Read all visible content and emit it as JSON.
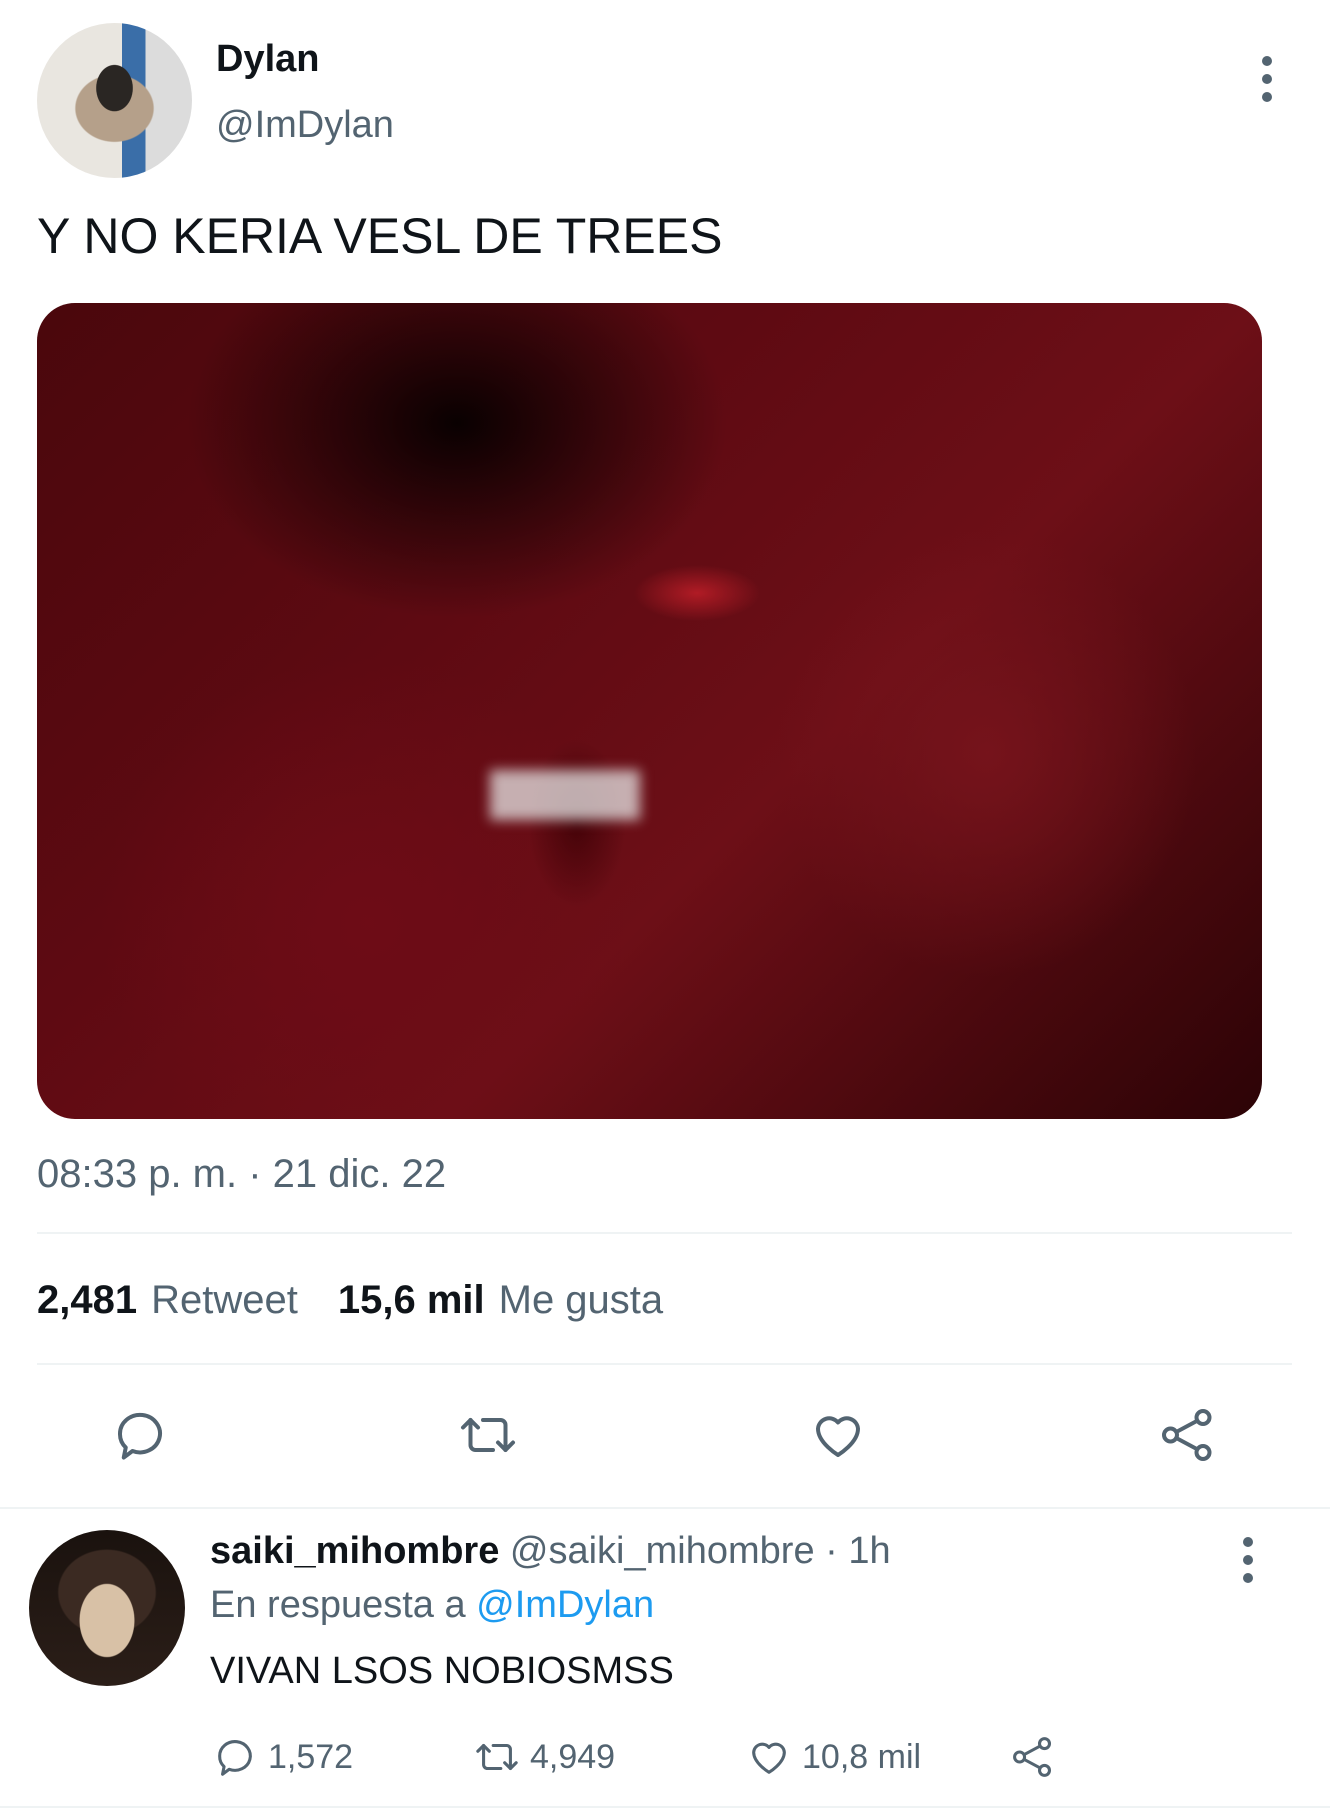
{
  "tweet": {
    "author_name": "Dylan",
    "author_handle": "@ImDylan",
    "text": "Y NO KERIA VESL DE TREES",
    "timestamp": "08:33 p. m. · 21 dic. 22",
    "retweet_count": "2,481",
    "retweet_label": "Retweet",
    "like_count": "15,6 mil",
    "like_label": "Me gusta"
  },
  "actions": {
    "reply_icon": "speech-bubble-icon",
    "retweet_icon": "retweet-arrows-icon",
    "like_icon": "heart-icon",
    "share_icon": "share-nodes-icon"
  },
  "reply": {
    "author_name": "saiki_mihombre",
    "author_handle": "@saiki_mihombre",
    "time": "· 1h",
    "in_reply_prefix": "En respuesta a",
    "in_reply_mention": "@ImDylan",
    "text": "VIVAN LSOS NOBIOSMSS",
    "reply_count": "1,572",
    "retweet_count": "4,949",
    "like_count": "10,8 mil"
  },
  "colors": {
    "text_primary": "#0f1419",
    "text_secondary": "#536471",
    "link": "#1d9bf0",
    "divider": "#eff3f4"
  }
}
